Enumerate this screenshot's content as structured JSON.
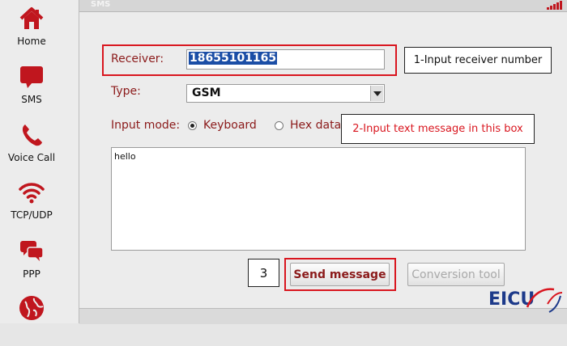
{
  "app": {
    "window_title": "SMS"
  },
  "sidebar": {
    "items": [
      {
        "label": "Home",
        "icon": "home-icon"
      },
      {
        "label": "SMS",
        "icon": "sms-icon"
      },
      {
        "label": "Voice Call",
        "icon": "phone-icon"
      },
      {
        "label": "TCP/UDP",
        "icon": "wifi-icon"
      },
      {
        "label": "PPP",
        "icon": "chat-icon"
      },
      {
        "label": "",
        "icon": "globe-icon"
      }
    ]
  },
  "form": {
    "receiver_label": "Receiver:",
    "receiver_value": "18655101165",
    "type_label": "Type:",
    "type_value": "GSM",
    "input_mode_label": "Input mode:",
    "mode_keyboard": "Keyboard",
    "mode_hex": "Hex data",
    "mode_selected": "Keyboard",
    "message_text": "hello"
  },
  "buttons": {
    "send": "Send message",
    "conversion": "Conversion tool"
  },
  "callouts": {
    "step1": "1-Input receiver number",
    "step2": "2-Input text message in this box",
    "step3": "3"
  },
  "logo": {
    "text": "EICU"
  },
  "colors": {
    "accent_red": "#d9161f",
    "label_red": "#8b1a1a",
    "selection_blue": "#1b4ea6",
    "logo_blue": "#1d3a8a"
  }
}
